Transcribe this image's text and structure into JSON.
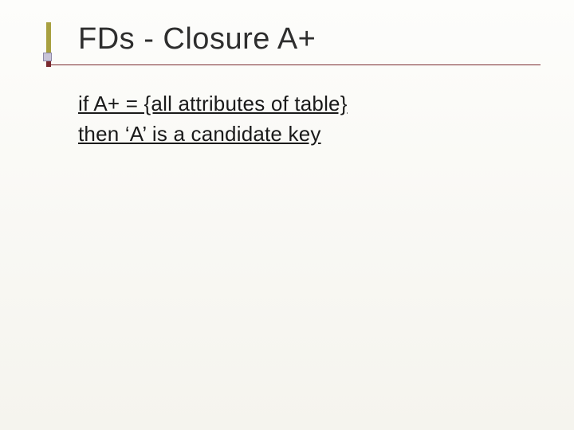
{
  "slide": {
    "title": "FDs - Closure A+",
    "body": {
      "line1": "if A+ = {all attributes of table}",
      "line2": "then ‘A’ is a candidate key"
    }
  }
}
